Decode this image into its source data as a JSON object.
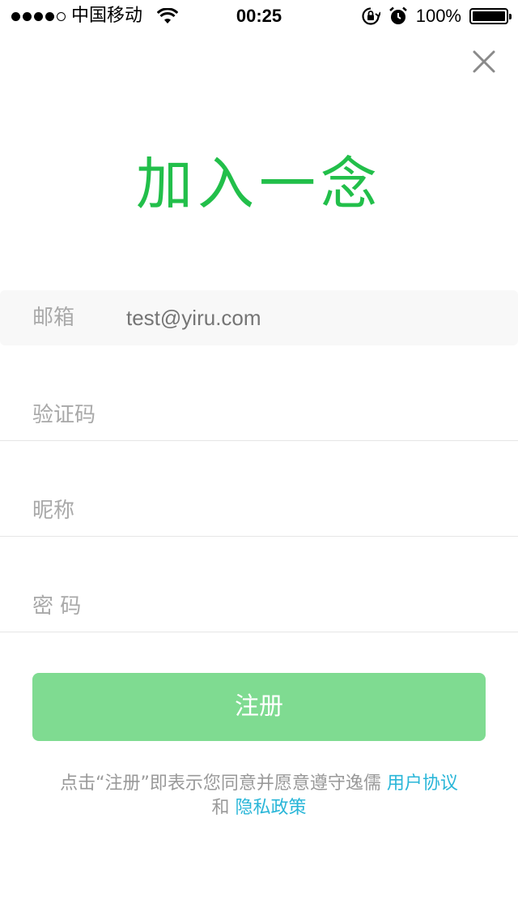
{
  "status_bar": {
    "carrier": "中国移动",
    "time": "00:25",
    "battery": "100%"
  },
  "title": "加入一念",
  "form": {
    "email_label": "邮箱",
    "email_placeholder": "test@yiru.com",
    "code_label": "验证码",
    "nickname_label": "昵称",
    "password_label": "密 码"
  },
  "register_label": "注册",
  "terms": {
    "prefix": "点击“注册”即表示您同意并愿意遵守逸儒",
    "user_agreement": "用户协议",
    "and": "和",
    "privacy_policy": "隐私政策"
  },
  "colors": {
    "accent": "#22bf4a",
    "button": "#7fdb91",
    "link": "#29b6d8"
  },
  "icons": [
    "signal-icon",
    "wifi-icon",
    "rotation-lock-icon",
    "alarm-icon",
    "battery-icon",
    "close-icon"
  ]
}
